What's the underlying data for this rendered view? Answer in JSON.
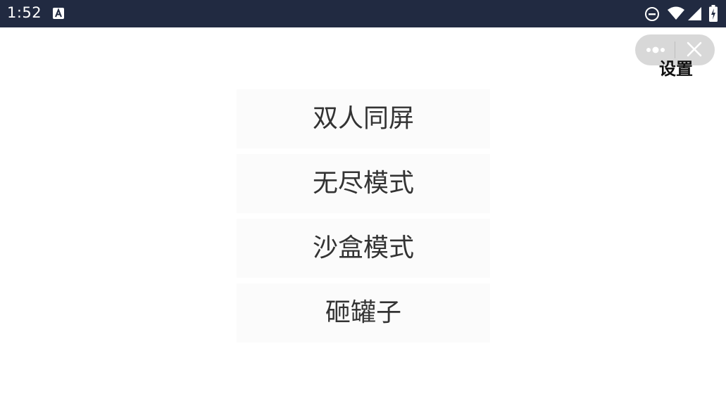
{
  "status_bar": {
    "time": "1:52",
    "app_icon": "a-letter-icon",
    "icons": [
      "do-not-disturb-icon",
      "wifi-icon",
      "cell-signal-icon",
      "battery-charging-icon"
    ],
    "background": "#212a41"
  },
  "capsule": {
    "more_icon": "more-dots-icon",
    "close_icon": "close-icon"
  },
  "settings": {
    "label": "设置"
  },
  "menu": {
    "items": [
      {
        "label": "双人同屏"
      },
      {
        "label": "无尽模式"
      },
      {
        "label": "沙盒模式"
      },
      {
        "label": "砸罐子"
      }
    ]
  }
}
